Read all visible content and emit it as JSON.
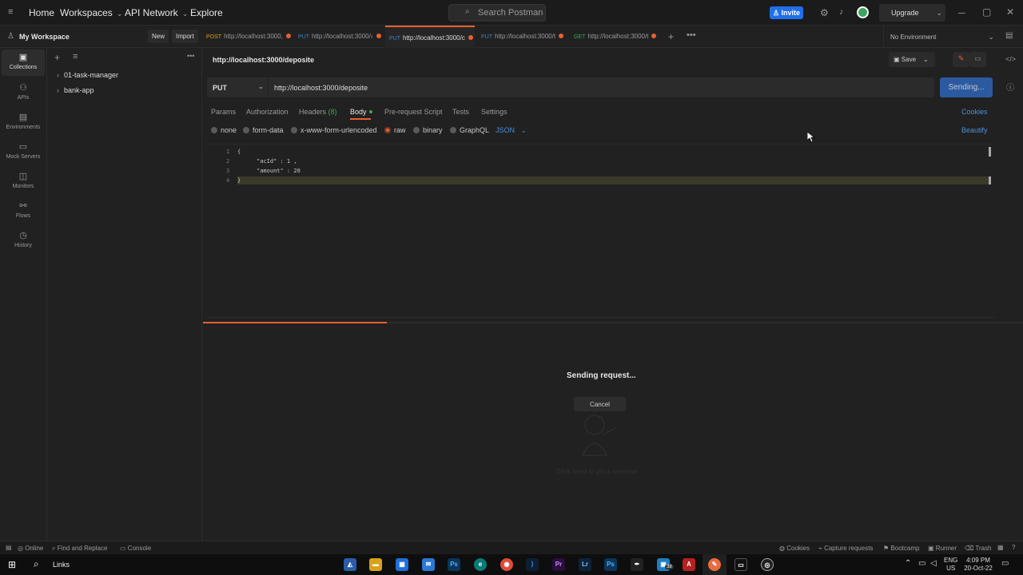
{
  "topbar": {
    "home": "Home",
    "workspaces": "Workspaces",
    "api_network": "API Network",
    "explore": "Explore",
    "search_placeholder": "Search Postman",
    "invite": "Invite",
    "upgrade": "Upgrade"
  },
  "workspace": {
    "name": "My Workspace",
    "new": "New",
    "import": "Import"
  },
  "tabs": [
    {
      "method": "POST",
      "label": "http://localhost:3000,"
    },
    {
      "method": "PUT",
      "label": "http://localhost:3000/‹"
    },
    {
      "method": "PUT",
      "label": "http://localhost:3000/c"
    },
    {
      "method": "PUT",
      "label": "http://localhost:3000/t"
    },
    {
      "method": "GET",
      "label": "http://localhost:3000/t"
    }
  ],
  "environment": "No Environment",
  "rail": [
    {
      "label": "Collections",
      "icon": "collections-icon"
    },
    {
      "label": "APIs",
      "icon": "apis-icon"
    },
    {
      "label": "Environments",
      "icon": "environments-icon"
    },
    {
      "label": "Mock Servers",
      "icon": "mock-servers-icon"
    },
    {
      "label": "Monitors",
      "icon": "monitors-icon"
    },
    {
      "label": "Flows",
      "icon": "flows-icon"
    },
    {
      "label": "History",
      "icon": "history-icon"
    }
  ],
  "collections": [
    "01-task-manager",
    "bank-app"
  ],
  "request": {
    "title": "http://localhost:3000/deposite",
    "save": "Save",
    "method": "PUT",
    "url": "http://localhost:3000/deposite",
    "send": "Sending...",
    "subtabs": [
      "Params",
      "Authorization",
      "Headers",
      "(8)",
      "Body",
      "Pre-request Script",
      "Tests",
      "Settings"
    ],
    "cookies": "Cookies",
    "body_types": [
      "none",
      "form-data",
      "x-www-form-urlencoded",
      "raw",
      "binary",
      "GraphQL"
    ],
    "format": "JSON",
    "beautify": "Beautify",
    "code_lines": [
      "{",
      "\"acId\" : 1 ,",
      "\"amount\" : 20",
      "}"
    ],
    "line_numbers": [
      "1",
      "2",
      "3",
      "4"
    ]
  },
  "response": {
    "status": "Sending request...",
    "cancel": "Cancel",
    "hint": "Click Send to get a response"
  },
  "statusbar": {
    "online": "Online",
    "find_replace": "Find and Replace",
    "console": "Console",
    "cookies": "Cookies",
    "capture": "Capture requests",
    "bootcamp": "Bootcamp",
    "runner": "Runner",
    "trash": "Trash"
  },
  "taskbar": {
    "links": "Links",
    "lang": "ENG",
    "region": "US",
    "time": "4:09 PM",
    "date": "20-Oct-22",
    "badge": "38"
  },
  "colors": {
    "accent_orange": "#e8602f",
    "send_blue": "#2b5aa0",
    "invite_blue": "#1f6feb",
    "put_method": "#3b82c4",
    "post_method": "#d4a017",
    "get_method": "#3aa55d"
  }
}
